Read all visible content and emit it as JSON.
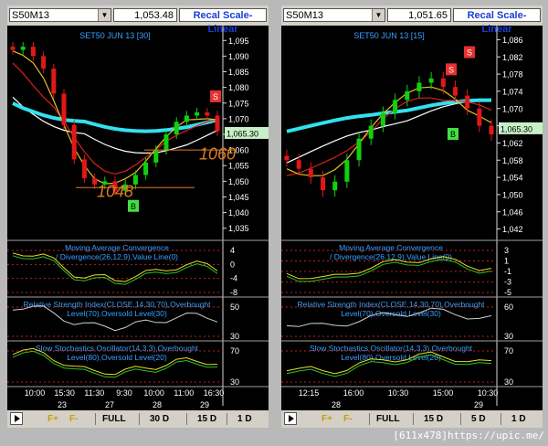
{
  "watermark": "[611x478]https://upic.me/",
  "charts": [
    {
      "id": "left",
      "symbol": "S50M13",
      "price": "1,053.48",
      "scale_button": "Recal Scale-Linear",
      "title": "SET50 JUN 13   [30]",
      "current_price": "1,065.30",
      "annotations": [
        "1060",
        "1048"
      ],
      "signals": [
        "S",
        "B"
      ],
      "price_ticks": [
        "1,095",
        "1,090",
        "1,085",
        "1,080",
        "1,075",
        "1,070",
        "1,065",
        "1,060",
        "1,055",
        "1,050",
        "1,045",
        "1,040",
        "1,035"
      ],
      "macd_title": "Moving Average Convergence / Divergence(26,12,9),Value Line(0)",
      "macd_ticks": [
        "4",
        "0",
        "-4",
        "-8"
      ],
      "rsi_title": "Relative Strength Index(CLOSE,14,30,70),Overbought Level(70),Oversold Level(30)",
      "rsi_ticks": [
        "50",
        "30"
      ],
      "stoch_title": "Slow Stochastics Oscillator(14,3,3),Overbought Level(80),Oversold Level(20)",
      "stoch_ticks": [
        "70",
        "30"
      ],
      "time_ticks": [
        "10:00",
        "15:30",
        "11:30",
        "9:30",
        "10:00",
        "11:00",
        "16:30"
      ],
      "date_ticks": [
        "23",
        "27",
        "28",
        "29"
      ],
      "toolbar": [
        "F+",
        "F-",
        "FULL",
        "30 D",
        "15 D",
        "1 D"
      ]
    },
    {
      "id": "right",
      "symbol": "S50M13",
      "price": "1,051.65",
      "scale_button": "Recal Scale-Linear",
      "title": "SET50 JUN 13   [15]",
      "current_price": "1,065.30",
      "signals": [
        "S",
        "S",
        "B"
      ],
      "price_ticks": [
        "1,086",
        "1,082",
        "1,078",
        "1,074",
        "1,070",
        "1,066",
        "1,062",
        "1,058",
        "1,054",
        "1,050",
        "1,046",
        "1,042"
      ],
      "macd_title": "Moving Average Convergence / Divergence(26,12,9),Value Line(0)",
      "macd_ticks": [
        "3",
        "1",
        "-1",
        "-3",
        "-5"
      ],
      "rsi_title": "Relative Strength Index(CLOSE,14,30,70),Overbought Level(70),Oversold Level(30)",
      "rsi_ticks": [
        "60",
        "30"
      ],
      "stoch_title": "Slow Stochastics Oscillator(14,3,3),Overbought Level(80),Oversold Level(20)",
      "stoch_ticks": [
        "70",
        "30"
      ],
      "time_ticks": [
        "12:15",
        "16:00",
        "10:30",
        "15:00",
        "10:30"
      ],
      "date_ticks": [
        "28",
        "29"
      ],
      "toolbar": [
        "F+",
        "F-",
        "FULL",
        "15 D",
        "5 D",
        "1 D"
      ]
    }
  ],
  "chart_data": [
    {
      "type": "line",
      "title": "SET50 JUN 13   [30]",
      "ylim": [
        1032,
        1098
      ],
      "series": [
        {
          "values": [
            1092,
            1093,
            1090,
            1086,
            1078,
            1068,
            1057,
            1051,
            1049,
            1050,
            1047,
            1049,
            1052,
            1056,
            1060,
            1065,
            1069,
            1071,
            1072,
            1071,
            1066
          ]
        }
      ]
    },
    {
      "type": "line",
      "title": "SET50 JUN 13   [15]",
      "ylim": [
        1040,
        1088
      ],
      "series": [
        {
          "values": [
            1058,
            1056,
            1054,
            1051,
            1053,
            1058,
            1063,
            1066,
            1069,
            1072,
            1074,
            1076,
            1077,
            1075,
            1073,
            1070,
            1066,
            1064
          ]
        }
      ]
    }
  ]
}
